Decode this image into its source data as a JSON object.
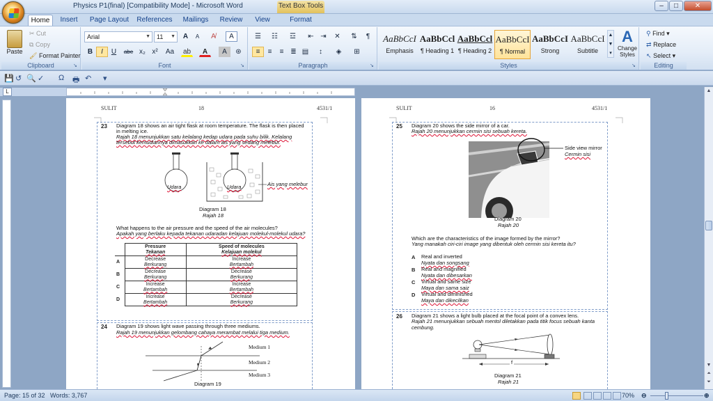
{
  "window": {
    "title": "Physics P1(final) [Compatibility Mode] - Microsoft Word",
    "context_tab": "Text Box Tools",
    "min": "–",
    "max": "□",
    "close": "✕"
  },
  "tabs": [
    "Home",
    "Insert",
    "Page Layout",
    "References",
    "Mailings",
    "Review",
    "View",
    "Format"
  ],
  "clipboard": {
    "paste": "Paste",
    "cut": "Cut",
    "copy": "Copy",
    "format_painter": "Format Painter",
    "label": "Clipboard"
  },
  "font": {
    "name": "Arial",
    "size": "11",
    "label": "Font",
    "grow": "A",
    "shrink": "A",
    "bold": "B",
    "italic": "I",
    "underline": "U",
    "strike": "abe",
    "sub": "x₂",
    "sup": "x²",
    "case": "Aa"
  },
  "paragraph": {
    "label": "Paragraph"
  },
  "styles": {
    "label": "Styles",
    "items": [
      {
        "preview": "AaBbCcI",
        "name": "Emphasis"
      },
      {
        "preview": "AaBbCcl",
        "name": "¶ Heading 1"
      },
      {
        "preview": "AaBbCcl",
        "name": "¶ Heading 2"
      },
      {
        "preview": "AaBbCcI",
        "name": "¶ Normal"
      },
      {
        "preview": "AaBbCcI",
        "name": "Strong"
      },
      {
        "preview": "AaBbCcI",
        "name": "Subtitle"
      }
    ],
    "change": "Change Styles"
  },
  "editing": {
    "label": "Editing",
    "find": "Find",
    "replace": "Replace",
    "select": "Select"
  },
  "page_left": {
    "header_left": "SULIT",
    "header_mid": "18",
    "header_right": "4531/1",
    "q23": {
      "num": "23",
      "en1": "Diagram 18 shows an air tight flask at room temperature. The flask is then placed",
      "en2": "in melting ice.",
      "my1": "Rajah 18 menunjukkan satu kelalang kedap udara pada suhu bilik. Kelalang",
      "my2": "tersebut kemudiannya dimasukkan ke dalam ais yang sedang melebur.",
      "udara": "Udara",
      "ais": "Ais yang melebur",
      "cap_en": "Diagram 18",
      "cap_my": "Rajah 18",
      "question_en": "What happens to the air pressure and the speed of the air molecules?",
      "question_my": "Apakah yang berlaku kepada tekanan udaradan kelajuan molekul-molekul udara?",
      "col1_en": "Pressure",
      "col1_my": "Tekanan",
      "col2_en": "Speed of molecules",
      "col2_my": "Kelajuan molekul",
      "options": [
        {
          "key": "A",
          "p_en": "Decrease",
          "p_my": "Berkurang",
          "s_en": "Increase",
          "s_my": "Bertambah"
        },
        {
          "key": "B",
          "p_en": "Decrease",
          "p_my": "Berkurang",
          "s_en": "Decrease",
          "s_my": "Berkurang"
        },
        {
          "key": "C",
          "p_en": "Increase",
          "p_my": "Bertambah",
          "s_en": "Increase",
          "s_my": "Bertambah"
        },
        {
          "key": "D",
          "p_en": "Increase",
          "p_my": "Bertambah",
          "s_en": "Decrease",
          "s_my": "Berkurang"
        }
      ]
    },
    "q24": {
      "num": "24",
      "en": "Diagram 19 shows light wave passing through three mediums.",
      "my": "Rajah 19 menunjukkan gelombang cahaya merambat melalui tiga medium.",
      "m1": "Medium 1",
      "m2": "Medium 2",
      "m3": "Medium 3",
      "cap": "Diagram 19"
    }
  },
  "page_right": {
    "header_left": "SULIT",
    "header_mid": "16",
    "header_right": "4531/1",
    "q25": {
      "num": "25",
      "en": "Diagram 20 shows the side mirror  of a car.",
      "my": "Rajah 20 menunjukkan cermin sisi sebuah kereta.",
      "mirror_en": "Side view mirror",
      "mirror_my": "Cermin sisi",
      "cap_en": "Diagram 20",
      "cap_my": "Rajah 20",
      "question_en": "Which are the characteristics of the image formed by the mirror?",
      "question_my": "Yang manakah ciri-ciri image yang dibentuk oleh cermin sisi kereta itu?",
      "options": [
        {
          "key": "A",
          "en": "Real and inverted",
          "my": "Nyata dan songsang"
        },
        {
          "key": "B",
          "en": "Real and magnified",
          "my": "Nyata dan dibesarkan"
        },
        {
          "key": "C",
          "en": "Virtual and same size",
          "my": "Maya dan sama saiz"
        },
        {
          "key": "D",
          "en": "Virtual and diminished",
          "my": "Maya dan dikecilkan"
        }
      ]
    },
    "q26": {
      "num": "26",
      "en": "Diagram 21 shows a light bulb placed at the focal point of a convex lens.",
      "my1": "Rajah 21 menunjukkan sebuah mentol diletakkan pada titik focus sebuah kanta",
      "my2": "cembung.",
      "f": "f",
      "cap_en": "Diagram 21",
      "cap_my": "Rajah 21"
    }
  },
  "status": {
    "page": "Page: 15 of 32",
    "words": "Words: 3,767",
    "zoom": "70%"
  }
}
